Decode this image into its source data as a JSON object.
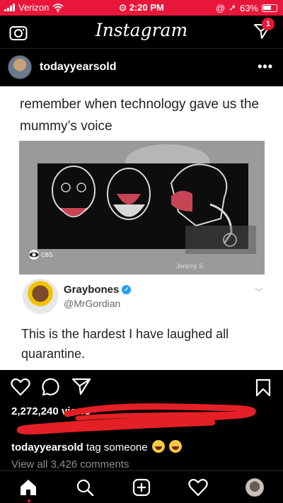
{
  "status_bar": {
    "carrier": "Verizon",
    "time": "2:20 PM",
    "battery": "63%"
  },
  "header": {
    "logo": "Instagram",
    "dm_badge_count": "1"
  },
  "post": {
    "username": "todayyearsold",
    "more": "•••",
    "image": {
      "tweet_top_text": "remember when technology gave us the mummy’s voice",
      "video_channel_logo": "CBS",
      "video_channel_mark": "Jeremy S",
      "tweet_author_name": "Graybones",
      "tweet_author_handle": "@MrGordian",
      "tweet_body": "This is the hardest I have laughed all quarantine."
    },
    "views": "2,272,240 views",
    "caption_user": "todayyearsold",
    "caption_text": "tag someone",
    "view_comments": "View all 3,426 comments"
  },
  "colors": {
    "accent": "#e8163a",
    "verified": "#1da1f2"
  },
  "icons": {
    "header": [
      "camera-icon",
      "paper-plane-icon"
    ],
    "actions": [
      "heart-icon",
      "comment-icon",
      "share-icon",
      "bookmark-icon"
    ],
    "bottom_nav": [
      "home-icon",
      "search-icon",
      "add-post-icon",
      "activity-heart-icon",
      "profile-avatar"
    ]
  }
}
